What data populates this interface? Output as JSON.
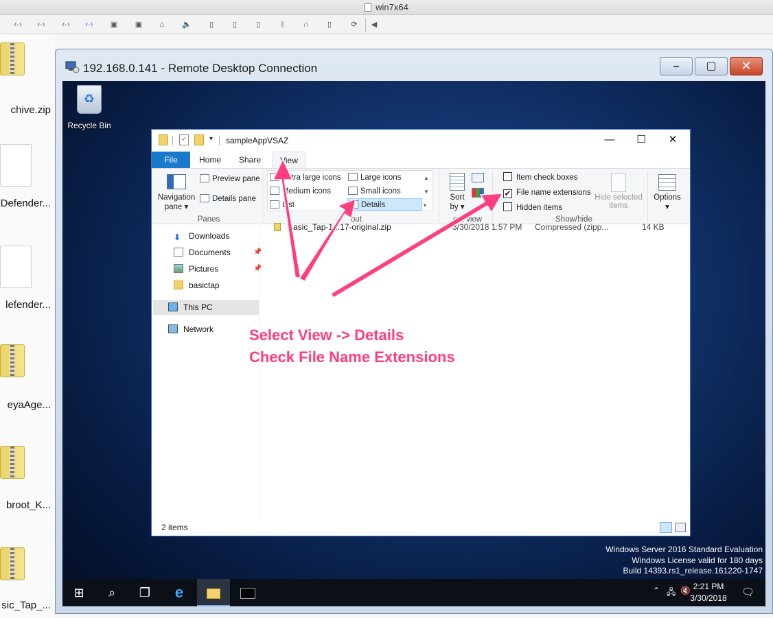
{
  "host": {
    "title": "win7x64"
  },
  "host_desktop": {
    "items": [
      {
        "label": "chive.zip"
      },
      {
        "label": "Defender..."
      },
      {
        "label": "lefender..."
      },
      {
        "label": "eyaAge..."
      },
      {
        "label": "broot_K..."
      },
      {
        "label": "sic_Tap_..."
      }
    ]
  },
  "rdp": {
    "title": "192.168.0.141 - Remote Desktop Connection",
    "minimize": "–",
    "maximize": "▢",
    "close": "✕"
  },
  "remote_desktop": {
    "recycle_bin_label": "Recycle Bin",
    "watermark": {
      "line1": "Windows Server 2016 Standard Evaluation",
      "line2": "Windows License valid for 180 days",
      "line3": "Build 14393.rs1_release.161220-1747"
    }
  },
  "explorer": {
    "title": "sampleAppVSAZ",
    "tabs": {
      "file": "File",
      "home": "Home",
      "share": "Share",
      "view": "View"
    },
    "ribbon": {
      "panes": {
        "navigation_pane_line1": "Navigation",
        "navigation_pane_line2": "pane",
        "preview_pane": "Preview pane",
        "details_pane": "Details pane",
        "group_label": "Panes"
      },
      "layout": {
        "extra_large_icons": "Extra large icons",
        "large_icons": "Large icons",
        "medium_icons": "Medium icons",
        "small_icons": "Small icons",
        "list": "List",
        "details": "Details",
        "group_label": "out"
      },
      "current_view": {
        "sort_by_line1": "Sort",
        "sort_by_line2": "by",
        "group_label": "ent view"
      },
      "show_hide": {
        "item_check_boxes": "Item check boxes",
        "file_name_extensions": "File name extensions",
        "hidden_items": "Hidden items",
        "hide_selected_line1": "Hide selected",
        "hide_selected_line2": "items",
        "group_label": "Show/hide",
        "item_check_boxes_checked": false,
        "file_name_extensions_checked": true,
        "hidden_items_checked": false
      },
      "options": "Options"
    },
    "nav": {
      "items": [
        {
          "label": "Downloads"
        },
        {
          "label": "Documents"
        },
        {
          "label": "Pictures"
        },
        {
          "label": "basictap"
        },
        {
          "label": "This PC"
        },
        {
          "label": "Network"
        }
      ]
    },
    "files": [
      {
        "name": "Basic_Tap-1...17-original.zip",
        "date": "3/30/2018 1:57 PM",
        "type": "Compressed (zipp...",
        "size": "14 KB"
      }
    ],
    "status": "2 items"
  },
  "taskbar": {
    "time": "2:21 PM",
    "date": "3/30/2018"
  },
  "annotation": {
    "line1": "Select View -> Details",
    "line2": "Check File Name Extensions",
    "color": "#ff3d7f"
  }
}
